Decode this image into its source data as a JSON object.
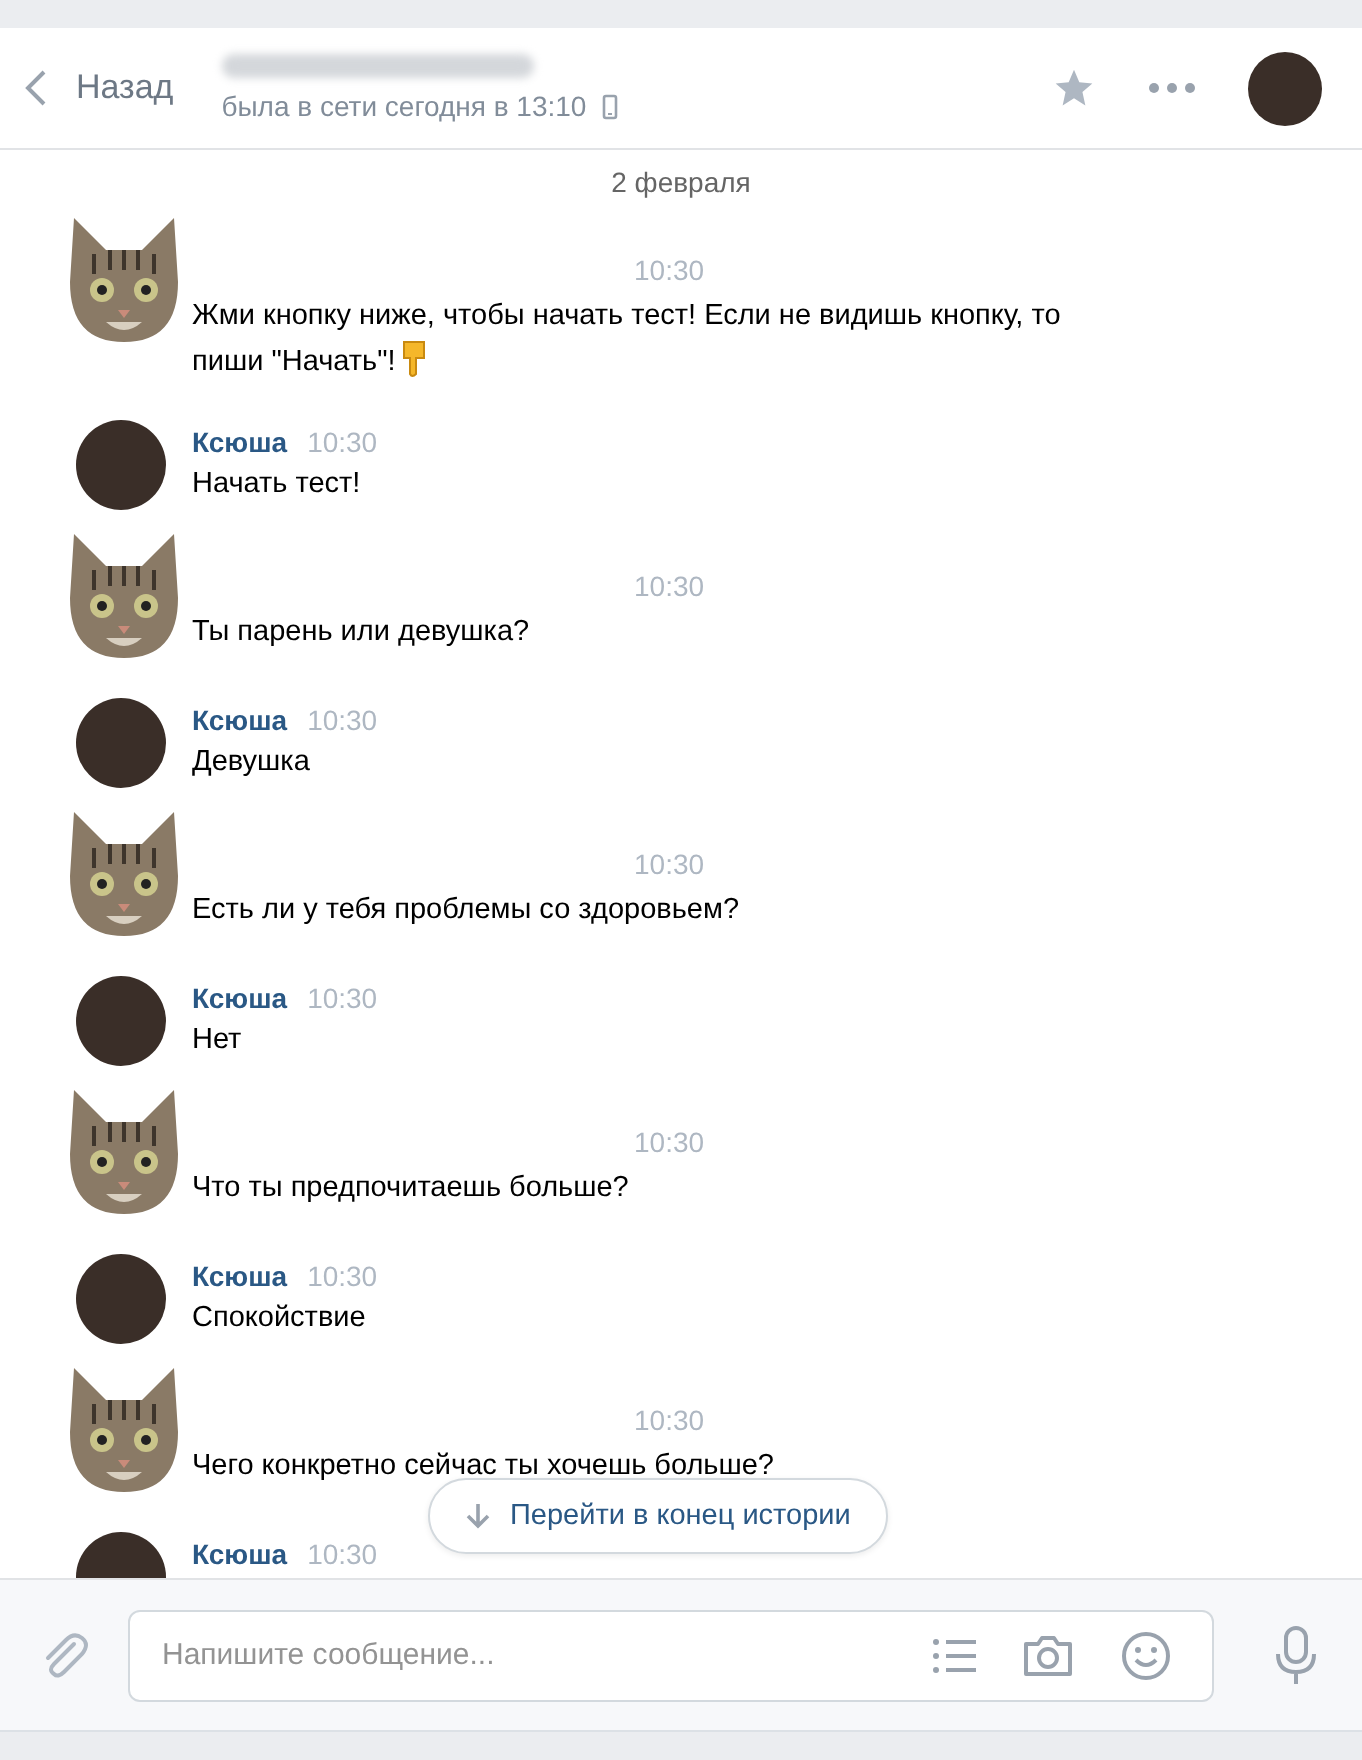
{
  "header": {
    "back": "Назад",
    "status": "была в сети сегодня в 13:10"
  },
  "date": "2 февраля",
  "messages": [
    {
      "kind": "bot",
      "time": "10:30",
      "text": "Жми кнопку ниже, чтобы начать тест! Если не видишь кнопку, то пиши \"Начать\"!"
    },
    {
      "kind": "user",
      "name": "Ксюша",
      "time": "10:30",
      "text": "Начать тест!"
    },
    {
      "kind": "bot",
      "time": "10:30",
      "text": "Ты парень или девушка?"
    },
    {
      "kind": "user",
      "name": "Ксюша",
      "time": "10:30",
      "text": "Девушка"
    },
    {
      "kind": "bot",
      "time": "10:30",
      "text": "Есть ли у тебя проблемы со здоровьем?"
    },
    {
      "kind": "user",
      "name": "Ксюша",
      "time": "10:30",
      "text": "Нет"
    },
    {
      "kind": "bot",
      "time": "10:30",
      "text": "Что ты предпочитаешь больше?"
    },
    {
      "kind": "user",
      "name": "Ксюша",
      "time": "10:30",
      "text": "Спокойствие"
    },
    {
      "kind": "bot",
      "time": "10:30",
      "text": "Чего конкретно сейчас ты хочешь больше?"
    },
    {
      "kind": "user",
      "name": "Ксюша",
      "time": "10:30"
    }
  ],
  "jump_button": "Перейти в конец истории",
  "composer": {
    "placeholder": "Напишите сообщение..."
  }
}
